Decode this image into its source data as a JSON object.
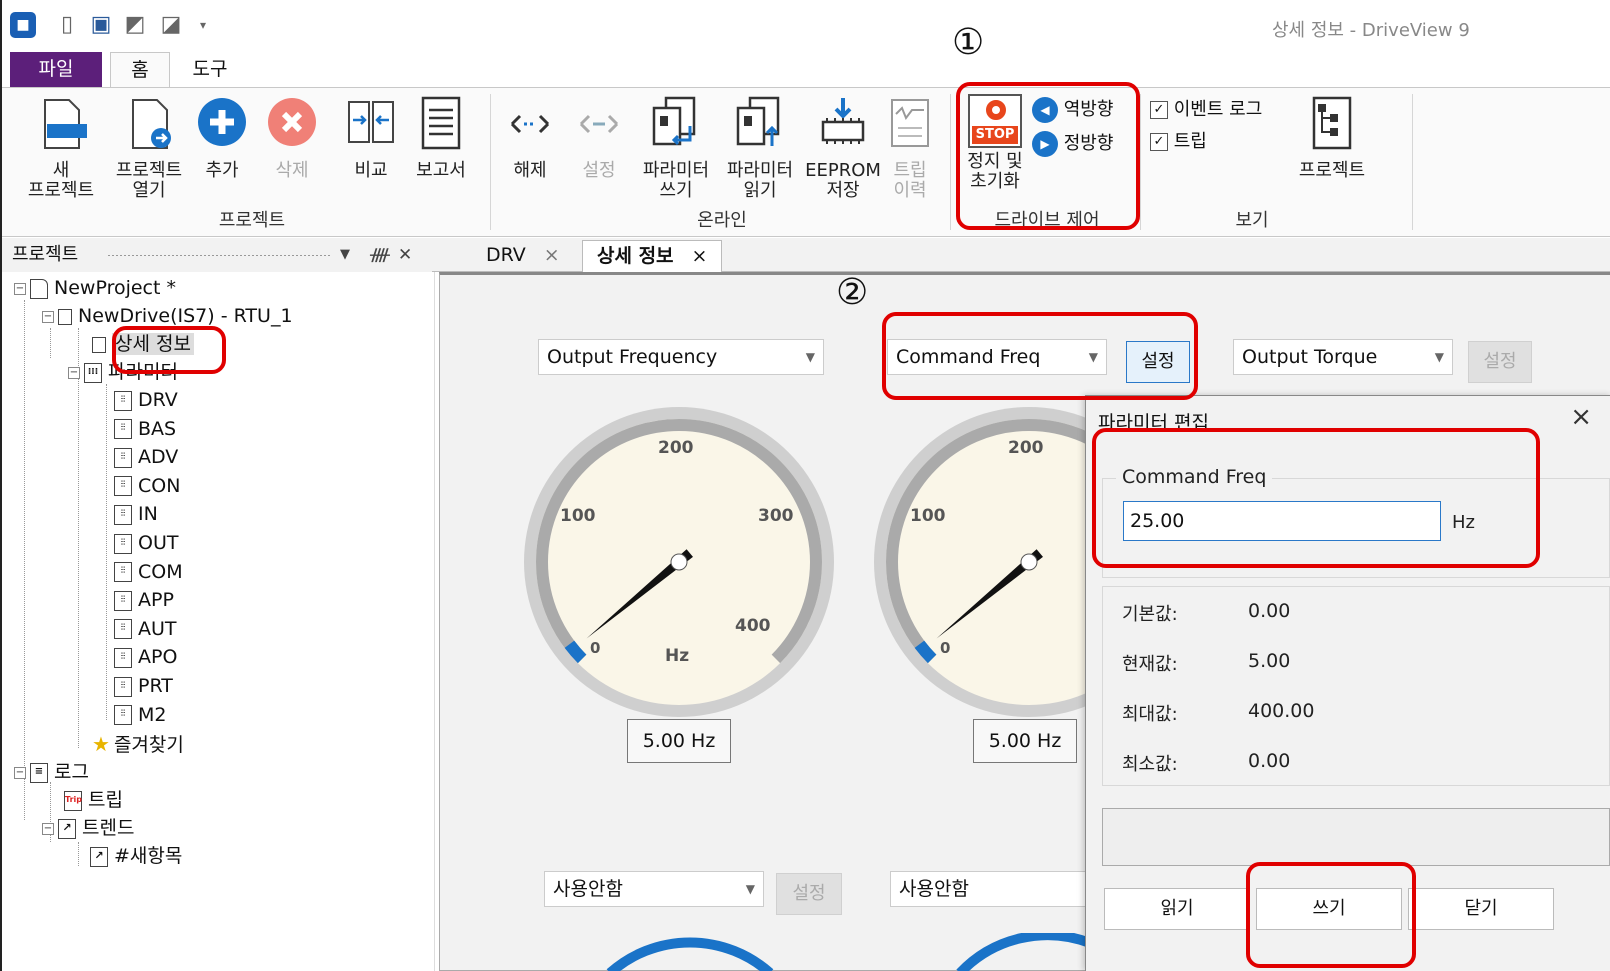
{
  "window": {
    "title": "상세 정보 - DriveView 9"
  },
  "menu": {
    "file": "파일",
    "home": "홈",
    "tools": "도구"
  },
  "ribbon": {
    "project_group": "프로젝트",
    "online_group": "온라인",
    "drive_group": "드라이브 제어",
    "view_group": "보기",
    "new_project": "새\n프로젝트",
    "new_line1": "새",
    "new_line2": "프로젝트",
    "open_line1": "프로젝트",
    "open_line2": "열기",
    "add": "추가",
    "delete": "삭제",
    "compare": "비교",
    "report": "보고서",
    "release": "해제",
    "setting": "설정",
    "param_write_1": "파라미터",
    "param_write_2": "쓰기",
    "param_read_1": "파라미터",
    "param_read_2": "읽기",
    "eeprom_1": "EEPROM",
    "eeprom_2": "저장",
    "trip_1": "트립",
    "trip_2": "이력",
    "stop_1": "정지 및",
    "stop_2": "초기화",
    "stop_icon_text": "STOP",
    "reverse": "역방향",
    "forward": "정방향",
    "event_log": "이벤트 로그",
    "trip_check": "트립",
    "project_view": "프로젝트"
  },
  "annotations": {
    "one": "①",
    "two": "②"
  },
  "panel": {
    "title": "프로젝트",
    "pin": "ᵖ",
    "close": "✕",
    "dropdown": "▼"
  },
  "tree": {
    "root": "NewProject *",
    "drive": "NewDrive(IS7) - RTU_1",
    "detail": "상세 정보",
    "params": "파라미터",
    "groups": [
      "DRV",
      "BAS",
      "ADV",
      "CON",
      "IN",
      "OUT",
      "COM",
      "APP",
      "AUT",
      "APO",
      "PRT",
      "M2"
    ],
    "favorites": "즐겨찾기",
    "log": "로그",
    "trip": "트립",
    "trend": "트렌드",
    "new_item": "#새항목"
  },
  "doctabs": [
    {
      "label": "DRV"
    },
    {
      "label": "상세 정보"
    }
  ],
  "monitor": {
    "combo1": "Output Frequency",
    "combo2": "Command Freq",
    "combo3": "Output Torque",
    "set": "설정",
    "gauge1": {
      "ticks": [
        "0",
        "100",
        "200",
        "300",
        "400"
      ],
      "unit": "Hz",
      "value": 5.0,
      "max": 400,
      "readout": "5.00 Hz"
    },
    "gauge2": {
      "ticks": [
        "0",
        "100",
        "200"
      ],
      "value": 5.0,
      "max": 400,
      "readout": "5.00 Hz"
    },
    "combo4": "사용안함",
    "combo5": "사용안함"
  },
  "dialog": {
    "title": "파라미터 편집",
    "param_name": "Command Freq",
    "input_value": "25.00",
    "unit": "Hz",
    "rows": [
      {
        "label": "기본값:",
        "value": "0.00"
      },
      {
        "label": "현재값:",
        "value": "5.00"
      },
      {
        "label": "최대값:",
        "value": "400.00"
      },
      {
        "label": "최소값:",
        "value": "0.00"
      }
    ],
    "read": "읽기",
    "write": "쓰기",
    "close": "닫기"
  }
}
